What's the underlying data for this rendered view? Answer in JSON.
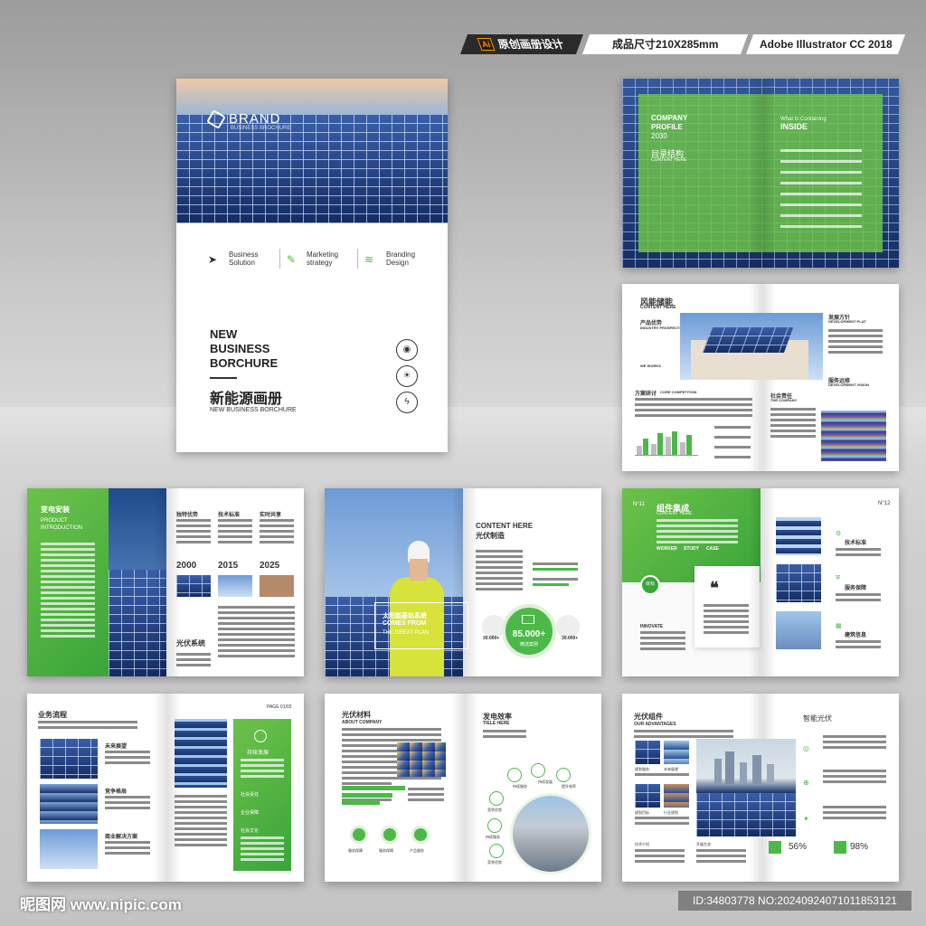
{
  "tags": {
    "design": "原创画册设计",
    "size": "成品尺寸210X285mm",
    "software": "Adobe Illustrator CC 2018",
    "ai_icon": "Ai"
  },
  "cover": {
    "brand": "BRAND",
    "brand_sub": "BUSINESS BROCHURE",
    "services": [
      {
        "l1": "Business",
        "l2": "Solution"
      },
      {
        "l1": "Marketing",
        "l2": "strategy"
      },
      {
        "l1": "Branding",
        "l2": "Design"
      }
    ],
    "title_lines": [
      "NEW",
      "BUSINESS",
      "BORCHURE"
    ],
    "title_cn": "新能源画册",
    "subtitle": "NEW BUSINESS BORCHURE"
  },
  "p1": {
    "l1": "COMPANY",
    "l2": "PROFILE",
    "year": "2030",
    "cn": "目录结构",
    "sub": "CONTENT HERE",
    "what": "What Is Containing",
    "inside": "INSIDE"
  },
  "p2": {
    "title": "风能储能",
    "sub": "CONTENT HERE",
    "a_t": "产品优势",
    "a_s": "INDUSTRY PROSPECTS",
    "b_t": "发展方针",
    "b_s": "DEVELOPMENT PLAT",
    "c_t": "方案研讨",
    "c_s": "CORE COMPETITION",
    "d_t": "服务远修",
    "d_s": "DEVELOPMENT VISION",
    "e_t": "社会责任",
    "e_s": "THE COMPANY",
    "we": "WE WORKS"
  },
  "p3": {
    "title": "变电安装",
    "l1": "PRODUCT",
    "l2": "INTRODUCTION",
    "h1": "独特优势",
    "h2": "技术标准",
    "h3": "实时共享",
    "years": [
      "2000",
      "2015",
      "2025"
    ],
    "sys": "光伏系统"
  },
  "p4": {
    "cn_big1": "太阳能基站系统",
    "en1": "COMES FROM",
    "en2": "THE GREAT PLAN",
    "title": "CONTENT HERE",
    "cn": "光伏制造",
    "stat": "85.000+",
    "stat_sub": "精选案例",
    "s1": "30.000+",
    "s2": "30.000+"
  },
  "p5": {
    "no1": "N°11",
    "title": "组件集成",
    "sub": "CONTENT HERE",
    "cols": [
      "WORKER",
      "STUDY",
      "CASE"
    ],
    "chip": "目标",
    "inno": "INNOVATE",
    "no2": "N°12",
    "items": [
      "技术标准",
      "服务保障",
      "建筑信息"
    ]
  },
  "p6": {
    "title": "业务流程",
    "page": "PAGE 01/02",
    "items": [
      "未来展望",
      "竞争格局",
      "商业解决方案"
    ],
    "green_t": "持续发展",
    "g_items": [
      "社会责任",
      "企业保障",
      "社会文化"
    ]
  },
  "p7": {
    "title": "光伏材料",
    "sub": "ABOUT COMPANY",
    "title2": "发电效率",
    "sub2": "TIELE HERE",
    "icons": [
      "服务保障",
      "服务保障",
      "产品服务"
    ],
    "net": [
      "持续服务",
      "持续发展",
      "提升效率",
      "竞争优势",
      "持续服务",
      "竞争优势"
    ]
  },
  "p8": {
    "title": "光伏组件",
    "sub": "OUR ADVANTAGES",
    "title2": "智能光伏",
    "p1": "56%",
    "p2": "98%",
    "labels": [
      "规划服务",
      "未来展望",
      "规划目标",
      "行业规划",
      "技术介绍",
      "开展生态"
    ]
  },
  "footer": {
    "site": "昵图网 www.nipic.com",
    "id": "ID:34803778 NO:20240924071011853121"
  }
}
